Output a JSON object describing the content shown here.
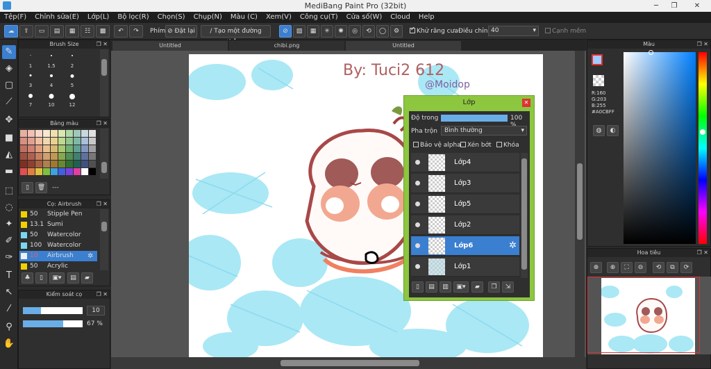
{
  "window": {
    "title": "MediBang Paint Pro (32bit)",
    "minimize": "─",
    "maximize": "❐",
    "close": "✕"
  },
  "menu": [
    "Tệp(F)",
    "Chỉnh sửa(E)",
    "Lớp(L)",
    "Bộ lọc(R)",
    "Chọn(S)",
    "Chụp(N)",
    "Màu (C)",
    "Xem(V)",
    "Công cụ(T)",
    "Cửa số(W)",
    "Cloud",
    "Help"
  ],
  "toolbar": {
    "brush_label": "Phím",
    "reset_label": "Đặt lại",
    "line_label": "Tạo một đường thẳng",
    "antialias_label": "Khử răng cưa",
    "correction_label": "Điều chỉnh",
    "correction_value": "40",
    "smooth_label": "Cạnh mềm"
  },
  "brush_size": {
    "title": "Brush Size",
    "sizes": [
      "1",
      "1.5",
      "2",
      "3",
      "4",
      "5",
      "7",
      "10",
      "12"
    ]
  },
  "palette": {
    "title": "Bảng màu",
    "colors": [
      "#e8b0a0",
      "#f0c0b0",
      "#f8d8c8",
      "#f8e8d0",
      "#f0e0b0",
      "#d8e8b0",
      "#b0d8a8",
      "#a0c8b8",
      "#c8d8e0",
      "#e0e0e0",
      "#d89080",
      "#e0a090",
      "#f0c0a0",
      "#f0d8b0",
      "#e8d090",
      "#c0d890",
      "#90c890",
      "#80b8a8",
      "#a8c0d8",
      "#c8c8c8",
      "#c07060",
      "#d08070",
      "#e0a080",
      "#e8c090",
      "#d8b870",
      "#a8c870",
      "#70b070",
      "#60a090",
      "#8098c0",
      "#a0a0a0",
      "#a05040",
      "#b06050",
      "#c88060",
      "#d0a070",
      "#c09850",
      "#88a850",
      "#509050",
      "#408070",
      "#6070a0",
      "#787878",
      "#803020",
      "#904030",
      "#a86040",
      "#b08050",
      "#a07830",
      "#688830",
      "#307030",
      "#206050",
      "#405080",
      "#505050",
      "#e05050",
      "#e08040",
      "#e0c040",
      "#80c040",
      "#40a0e0",
      "#4060e0",
      "#8040e0",
      "#e040a0",
      "#ffffff",
      "#000000"
    ],
    "footer_text": "---"
  },
  "brushes": {
    "title": "Cọ: Airbrush",
    "items": [
      {
        "size": "50",
        "name": "Stipple Pen",
        "color": "#f0d000"
      },
      {
        "size": "13.1",
        "name": "Sumi",
        "color": "#f0d000"
      },
      {
        "size": "50",
        "name": "Watercolor",
        "color": "#7ad7f0"
      },
      {
        "size": "100",
        "name": "Watercolor (Wet)",
        "color": "#7ad7f0"
      },
      {
        "size": "10",
        "name": "Airbrush",
        "color": "#f0f0f0"
      },
      {
        "size": "50",
        "name": "Acrylic",
        "color": "#f0d000"
      }
    ]
  },
  "brush_control": {
    "title": "Kiểm soát cọ",
    "size_value": "10",
    "opacity_value": "67 %",
    "size_fraction": 0.3,
    "opacity_fraction": 0.67
  },
  "tabs": [
    "Untitled",
    "chibi.png",
    "Untitled"
  ],
  "layers_panel": {
    "title": "Lớp",
    "opacity_label": "Độ trong",
    "opacity_value": "100 %",
    "opacity_fraction": 1.0,
    "blend_label": "Pha trộn",
    "blend_value": "Bình thường",
    "protect_alpha": "Bảo vệ alpha",
    "clipping": "Xén bớt",
    "lock": "Khóa",
    "layers": [
      {
        "name": "Lớp4",
        "selected": false
      },
      {
        "name": "Lớp3",
        "selected": false
      },
      {
        "name": "Lớp5",
        "selected": false
      },
      {
        "name": "Lớp2",
        "selected": false
      },
      {
        "name": "Lớp6",
        "selected": true
      },
      {
        "name": "Lớp1",
        "selected": false
      }
    ]
  },
  "color_panel": {
    "title": "Màu",
    "r": "R:160",
    "g": "G:203",
    "b": "B:255",
    "hex": "#A0CBFF"
  },
  "navigator": {
    "title": "Hoa tiêu"
  },
  "canvas_text": {
    "line1": "By: Tuci2 612",
    "line2": "@Moidop"
  }
}
